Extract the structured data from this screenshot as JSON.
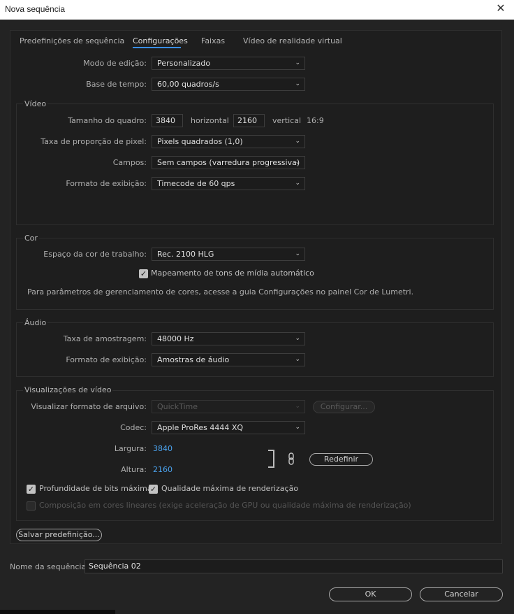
{
  "window": {
    "title": "Nova sequência"
  },
  "tabs": [
    "Predefinições de sequência",
    "Configurações",
    "Faixas",
    "Vídeo de realidade virtual"
  ],
  "top": {
    "edit_mode_label": "Modo de edição:",
    "edit_mode_value": "Personalizado",
    "timebase_label": "Base de tempo:",
    "timebase_value": "60,00  quadros/s"
  },
  "video": {
    "title": "Vídeo",
    "frame_size_label": "Tamanho do quadro:",
    "frame_width": "3840",
    "horizontal_label": "horizontal",
    "frame_height": "2160",
    "vertical_label": "vertical",
    "aspect": "16:9",
    "pixel_aspect_label": "Taxa de proporção de pixel:",
    "pixel_aspect_value": "Pixels quadrados (1,0)",
    "fields_label": "Campos:",
    "fields_value": "Sem campos (varredura progressiva)",
    "display_format_label": "Formato de exibição:",
    "display_format_value": "Timecode de 60 qps"
  },
  "color": {
    "title": "Cor",
    "working_space_label": "Espaço da cor de trabalho:",
    "working_space_value": "Rec. 2100 HLG",
    "tone_mapping_label": "Mapeamento de tons de mídia automático",
    "tone_mapping_checked": true,
    "info": "Para parâmetros de gerenciamento de cores, acesse a guia Configurações no painel Cor de Lumetri."
  },
  "audio": {
    "title": "Áudio",
    "sample_rate_label": "Taxa de amostragem:",
    "sample_rate_value": "48000 Hz",
    "display_format_label": "Formato de exibição:",
    "display_format_value": "Amostras de áudio"
  },
  "previews": {
    "title": "Visualizações de vídeo",
    "file_format_label": "Visualizar formato de arquivo:",
    "file_format_value": "QuickTime",
    "configure_label": "Configurar...",
    "codec_label": "Codec:",
    "codec_value": "Apple ProRes 4444 XQ",
    "width_label": "Largura:",
    "width_value": "3840",
    "height_label": "Altura:",
    "height_value": "2160",
    "reset_label": "Redefinir",
    "max_bit_depth_label": "Profundidade de bits máxima",
    "max_render_quality_label": "Qualidade máxima de renderização",
    "linear_composite_label": "Composição em cores lineares (exige aceleração de GPU ou qualidade máxima de renderização)"
  },
  "save_preset_label": "Salvar predefinição...",
  "sequence_name_label": "Nome da sequência:",
  "sequence_name_value": "Sequência 02",
  "ok_label": "OK",
  "cancel_label": "Cancelar",
  "colors": {
    "accent": "#3a8ee6",
    "link_value": "#4ba3ef",
    "background": "#232323",
    "panel": "#1e1e1e"
  }
}
